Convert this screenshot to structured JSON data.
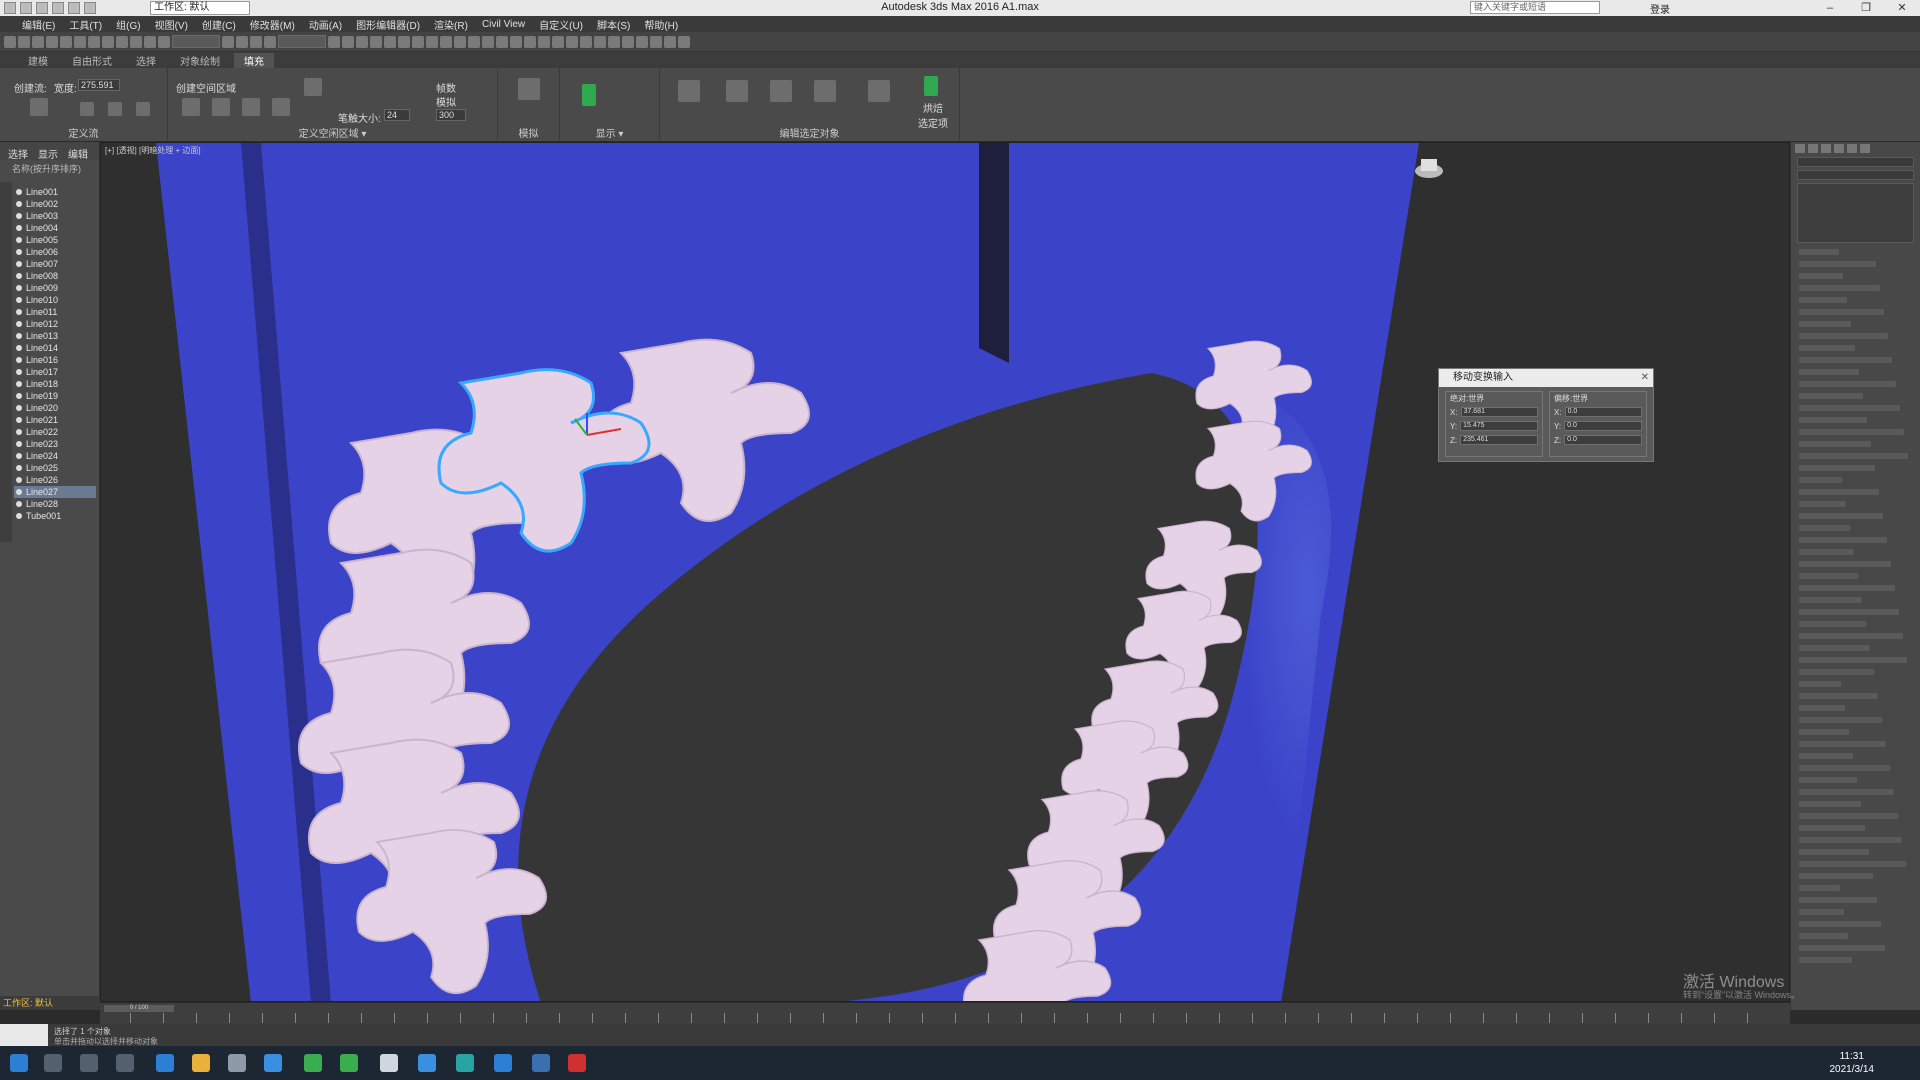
{
  "window": {
    "title": "Autodesk 3ds Max 2016    A1.max",
    "workspace": "工作区: 默认",
    "help_search_placeholder": "键入关键字或短语",
    "login": "登录",
    "minimize": "–",
    "restore": "❐",
    "close": "✕"
  },
  "menu": [
    "编辑(E)",
    "工具(T)",
    "组(G)",
    "视图(V)",
    "创建(C)",
    "修改器(M)",
    "动画(A)",
    "图形编辑器(D)",
    "渲染(R)",
    "Civil View",
    "自定义(U)",
    "脚本(S)",
    "帮助(H)"
  ],
  "ribbon_tabs": [
    {
      "label": "建模",
      "active": false
    },
    {
      "label": "自由形式",
      "active": false
    },
    {
      "label": "选择",
      "active": false
    },
    {
      "label": "对象绘制",
      "active": false
    },
    {
      "label": "填充",
      "active": true
    }
  ],
  "ribbon": {
    "create_flow_label": "创建流:",
    "width_label": "宽度:",
    "width_value": "275.591",
    "define_flow_panel": "定义流",
    "create_space_label": "创建空间区域",
    "define_space_panel": "定义空闲区域 ▾",
    "stride_label": "笔触大小:",
    "stride_value": "24",
    "sim_count_label": "帧数",
    "sim_frames_label": "模拟",
    "frames_value": "300",
    "simulate_panel": "模拟",
    "display_panel": "显示 ▾",
    "edit_selected_panel": "编辑选定对象",
    "bake_label": "烘焙\n选定项"
  },
  "scene_explorer": {
    "tabs": [
      "选择",
      "显示",
      "编辑"
    ],
    "header": "名称(按升序排序)",
    "items": [
      "Line001",
      "Line002",
      "Line003",
      "Line004",
      "Line005",
      "Line006",
      "Line007",
      "Line008",
      "Line009",
      "Line010",
      "Line011",
      "Line012",
      "Line013",
      "Line014",
      "Line016",
      "Line017",
      "Line018",
      "Line019",
      "Line020",
      "Line021",
      "Line022",
      "Line023",
      "Line024",
      "Line025",
      "Line026",
      "Line027",
      "Line028",
      "Tube001"
    ],
    "selected_index": 25,
    "footer": "工作区: 默认"
  },
  "viewport": {
    "label": "[+] [透视] [明暗处理 + 边面]",
    "bg_color": "#2f2f2f",
    "wall_color": "#3b44c8",
    "piece_color": "#e6d2e6",
    "selection_color": "#39a9ff"
  },
  "dialog": {
    "title": "移动变换输入",
    "close": "✕",
    "group_abs": "绝对:世界",
    "group_off": "偏移:世界",
    "abs": {
      "x": "37.681",
      "y": "15.475",
      "z": "235.461"
    },
    "off": {
      "x": "0.0",
      "y": "0.0",
      "z": "0.0"
    }
  },
  "timeline": {
    "slider": "0 / 100"
  },
  "status": {
    "selected": "选择了 1 个对象",
    "hint": "单击并拖动以选择并移动对象"
  },
  "clock": {
    "time": "11:31",
    "date": "2021/3/14"
  },
  "watermark": {
    "line1": "激活 Windows",
    "line2": "转到“设置”以激活 Windows。"
  }
}
